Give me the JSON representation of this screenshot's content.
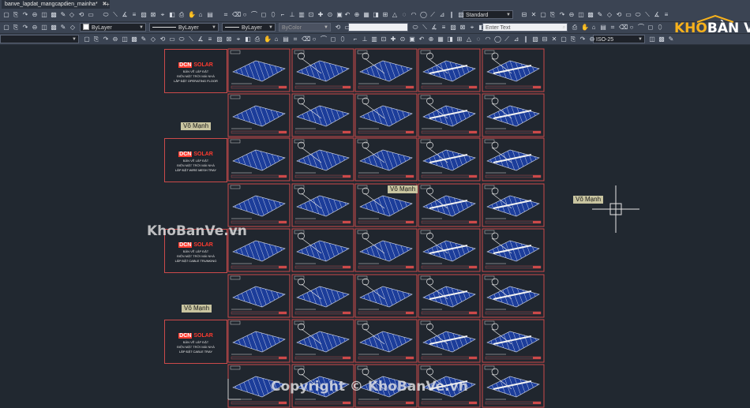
{
  "app": {
    "tab_title": "banve_lapdat_mangcapdien_mainha*",
    "tab_close": "✖",
    "new_tab": "+"
  },
  "toolbar": {
    "text_style": "Standard",
    "layer_color": "ByLayer",
    "linetype": "ByLayer",
    "lineweight": "ByLayer",
    "plot_style": "ByColor",
    "enter_text_placeholder": "Enter Text",
    "dim_style": "ISO-25"
  },
  "brand": {
    "name_part1": "KHO",
    "name_part2": "BÀN VẼ"
  },
  "drawing": {
    "cover_sheets": [
      {
        "logo_mark": "DCN",
        "logo_text": "SOLAR",
        "line1": "BẢN VẼ LẮP ĐẶT",
        "line2": "ĐIỆN MẶT TRỜI MÁI NHÀ",
        "line3": "LẮP ĐẶT OPERATING FLOOR"
      },
      {
        "logo_mark": "DCN",
        "logo_text": "SOLAR",
        "line1": "BẢN VẼ LẮP ĐẶT",
        "line2": "ĐIỆN MẶT TRỜI MÁI NHÀ",
        "line3": "LẮP ĐẶT WIRE MESH TRAY"
      },
      {
        "logo_mark": "DCN",
        "logo_text": "SOLAR",
        "line1": "BẢN VẼ LẮP ĐẶT",
        "line2": "ĐIỆN MẶT TRỜI MÁI NHÀ",
        "line3": "LẮP ĐẶT CABLE TRUNKING"
      },
      {
        "logo_mark": "DCN",
        "logo_text": "SOLAR",
        "line1": "BẢN VẼ LẮP ĐẶT",
        "line2": "ĐIỆN MẶT TRỜI MÁI NHÀ",
        "line3": "LẮP ĐẶT CABLE TRAY"
      }
    ],
    "author_labels": [
      "Võ Mạnh",
      "Võ Mạnh",
      "Võ Mạnh",
      "Võ Mạnh"
    ]
  },
  "watermarks": {
    "center": "KhoBanVe.vn",
    "bottom": "Copyright © KhoBanVe.vn"
  }
}
